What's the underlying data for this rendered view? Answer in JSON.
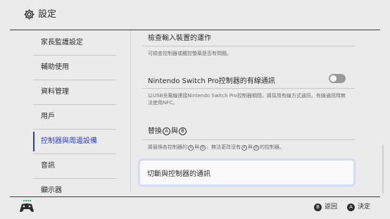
{
  "header": {
    "title": "設定",
    "icon": "gear-icon"
  },
  "sidebar": {
    "items": [
      {
        "label": "家長監護設定"
      },
      {
        "label": "輔助使用"
      },
      {
        "label": "資料管理"
      },
      {
        "label": "用戶"
      },
      {
        "label": "控制器與周邊設備",
        "active": true
      },
      {
        "label": "音訊"
      },
      {
        "label": "顯示器"
      }
    ]
  },
  "content": {
    "rows": [
      {
        "title": "檢查輸入裝置的運作",
        "desc": "可檢查控制器或觸控螢幕是否有問題。"
      },
      {
        "title": "Nintendo Switch Pro控制器的有線通訊",
        "desc": "以USB充電線連接Nintendo Switch Pro控制器期間，將採用有線方式通訊。有線通訊時無法使用NFC。",
        "toggle": "off"
      },
      {
        "title_pre": "替換",
        "title_a": "A",
        "title_mid": "與",
        "title_b": "B",
        "desc_pre": "將替換各控制器的",
        "desc_a": "A",
        "desc_mid1": "與",
        "desc_b": "B",
        "desc_mid2": "。無法更改沒有",
        "desc_a2": "A",
        "desc_mid3": "與",
        "desc_b2": "B",
        "desc_post": "的控制器。"
      },
      {
        "title": "切斷與控制器的通訊",
        "focused": true
      }
    ]
  },
  "footer": {
    "back_button": "B",
    "back_label": "返回",
    "ok_button": "A",
    "ok_label": "決定",
    "controller_icon": "controller-icon"
  },
  "colors": {
    "accent": "#2b3cc6",
    "background": "#ebebeb",
    "text": "#2d2d2d"
  }
}
